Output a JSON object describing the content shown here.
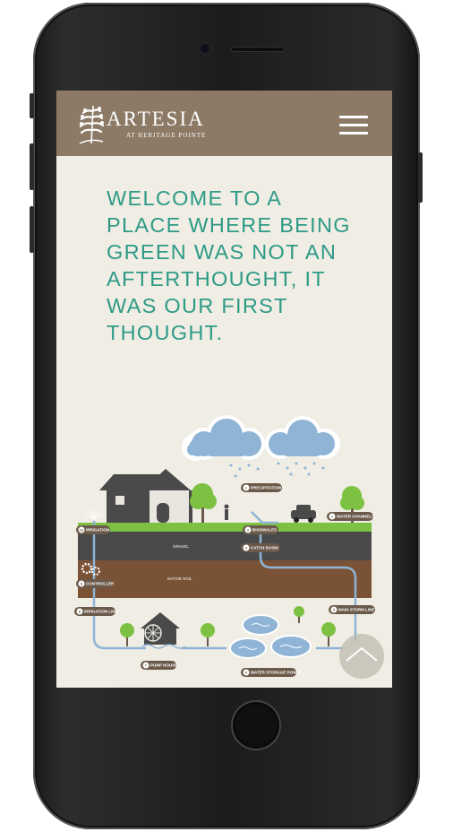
{
  "brand": {
    "name": "ARTESIA",
    "tagline": "AT HERITAGE POINTE"
  },
  "hero": {
    "headline": "WELCOME TO A PLACE WHERE BEING GREEN WAS NOT AN AFTERTHOUGHT, IT WAS OUR FIRST THOUGHT."
  },
  "diagram": {
    "layers": {
      "gravel": "GRAVEL",
      "native_soil": "NATIVE SOIL"
    },
    "labels": [
      {
        "num": "1",
        "text": "PRECIPITATION"
      },
      {
        "num": "2",
        "text": "WATER CHANNELS"
      },
      {
        "num": "3",
        "text": "BIOSWALES"
      },
      {
        "num": "4",
        "text": "CATCH BASIN"
      },
      {
        "num": "5",
        "text": "MAIN STORM LINE"
      },
      {
        "num": "6",
        "text": "WATER STORAGE PONDS"
      },
      {
        "num": "7",
        "text": "PUMP HOUSE"
      },
      {
        "num": "8",
        "text": "IRRIGATION LINE"
      },
      {
        "num": "9",
        "text": "CONTROLLER"
      },
      {
        "num": "10",
        "text": "IRRIGATION"
      }
    ]
  },
  "colors": {
    "header": "#8c7a66",
    "screen_bg": "#efede4",
    "headline": "#2e9a86",
    "grass": "#7dc142",
    "road": "#4a4a4a",
    "soil": "#7a5236",
    "cloud": "#8fb4d6",
    "label_bg": "#6b5a4a"
  },
  "icons": {
    "menu": "hamburger-icon",
    "logo": "tree-icon",
    "back_to_top": "chevron-up-icon"
  }
}
